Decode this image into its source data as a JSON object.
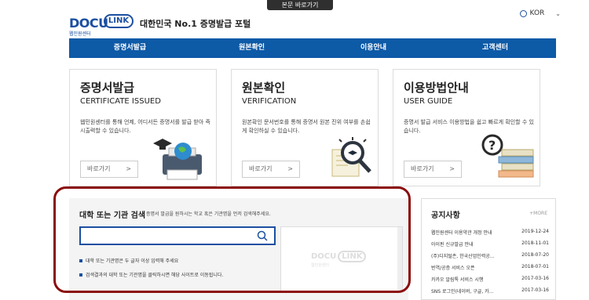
{
  "skip_link": "본문 바로가기",
  "brand": {
    "logo_main": "DOCU",
    "logo_link": "LINK",
    "logo_sub": "웹민원센터",
    "tagline": "대한민국 No.1 증명발급 포털"
  },
  "language": {
    "label": "KOR"
  },
  "nav": {
    "items": [
      {
        "label": "증명서발급"
      },
      {
        "label": "원본확인"
      },
      {
        "label": "이용안내"
      },
      {
        "label": "고객센터"
      }
    ]
  },
  "cards": [
    {
      "title": "증명서발급",
      "subtitle": "CERTIFICATE ISSUED",
      "desc": "웹민원센터를 통해 언제, 어디서든 증명서를 발급 받아 즉시출력할 수 있습니다.",
      "button": "바로가기"
    },
    {
      "title": "원본확인",
      "subtitle": "VERIFICATION",
      "desc": "원본확인 문서번호를 통해 증명서 원본 진위 여부를 손쉽게 확인하실 수 있습니다.",
      "button": "바로가기"
    },
    {
      "title": "이용방법안내",
      "subtitle": "USER GUIDE",
      "desc": "증명서 발급 서비스 이용방법을 쉽고 빠르게 확인할 수 있습니다.",
      "button": "바로가기"
    }
  ],
  "arrow": ">",
  "search": {
    "title": "대학 또는 기관 검색",
    "desc": "증명서 발급을 원하시는 학교 혹은 기관명을 먼저 검색해주세요.",
    "value": "",
    "notes": [
      "대학 또는 기관명은 두 글자 이상 입력해 주세요",
      "검색결과의 대학 또는 기관명을 클릭하시면 해당 사이트로 이동됩니다."
    ]
  },
  "notice": {
    "title": "공지사항",
    "more": "+MORE",
    "items": [
      {
        "title": "웹민원센터 이용약관 개정 안내",
        "date": "2019-12-24"
      },
      {
        "title": "아이핀 신규발급 안내",
        "date": "2018-11-01"
      },
      {
        "title": "(주)디지털존, 한국산업인력공...",
        "date": "2018-07-20"
      },
      {
        "title": "번역/공증 서비스 오픈",
        "date": "2018-07-01"
      },
      {
        "title": "카카오 알림톡 서비스 시행",
        "date": "2017-03-16"
      },
      {
        "title": "SNS 로그인(네이버, 구글, 카...",
        "date": "2017-03-16"
      }
    ]
  },
  "colors": {
    "primary": "#0d5aa7",
    "highlight": "#8b0c0c"
  }
}
